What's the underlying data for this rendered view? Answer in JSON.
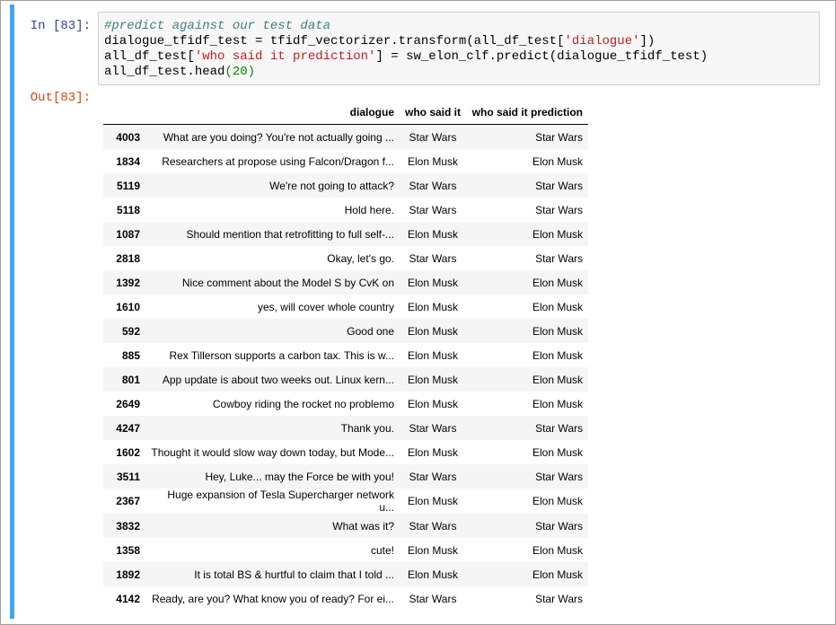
{
  "cell": {
    "in_prompt": "In [83]:",
    "out_prompt": "Out[83]:",
    "code": {
      "comment": "#predict against our test data",
      "line2_a": "dialogue_tfidf_test = tfidf_vectorizer.transform(all_df_test[",
      "line2_str": "'dialogue'",
      "line2_b": "])",
      "line3_a": "all_df_test[",
      "line3_str": "'who said it prediction'",
      "line3_b": "] = sw_elon_clf.predict(dialogue_tfidf_test)",
      "line4_a": "all_df_test.head",
      "line4_num": "(20)"
    }
  },
  "table": {
    "columns": [
      "",
      "dialogue",
      "who said it",
      "who said it prediction"
    ],
    "rows": [
      {
        "index": "4003",
        "dialogue": "What are you doing? You're not actually going ...",
        "who": "Star Wars",
        "pred": "Star Wars"
      },
      {
        "index": "1834",
        "dialogue": "Researchers at propose using Falcon/Dragon f...",
        "who": "Elon Musk",
        "pred": "Elon Musk"
      },
      {
        "index": "5119",
        "dialogue": "We're not going to attack?",
        "who": "Star Wars",
        "pred": "Star Wars"
      },
      {
        "index": "5118",
        "dialogue": "Hold here.",
        "who": "Star Wars",
        "pred": "Star Wars"
      },
      {
        "index": "1087",
        "dialogue": "Should mention that retrofitting to full self-...",
        "who": "Elon Musk",
        "pred": "Elon Musk"
      },
      {
        "index": "2818",
        "dialogue": "Okay, let's go.",
        "who": "Star Wars",
        "pred": "Star Wars"
      },
      {
        "index": "1392",
        "dialogue": "Nice comment about the Model S by CvK on",
        "who": "Elon Musk",
        "pred": "Elon Musk"
      },
      {
        "index": "1610",
        "dialogue": "yes, will cover whole country",
        "who": "Elon Musk",
        "pred": "Elon Musk"
      },
      {
        "index": "592",
        "dialogue": "Good one",
        "who": "Elon Musk",
        "pred": "Elon Musk"
      },
      {
        "index": "885",
        "dialogue": "Rex Tillerson supports a carbon tax. This is w...",
        "who": "Elon Musk",
        "pred": "Elon Musk"
      },
      {
        "index": "801",
        "dialogue": "App update is about two weeks out. Linux kern...",
        "who": "Elon Musk",
        "pred": "Elon Musk"
      },
      {
        "index": "2649",
        "dialogue": "Cowboy riding the rocket no problemo",
        "who": "Elon Musk",
        "pred": "Elon Musk"
      },
      {
        "index": "4247",
        "dialogue": "Thank you.",
        "who": "Star Wars",
        "pred": "Star Wars"
      },
      {
        "index": "1602",
        "dialogue": "Thought it would slow way down today, but Mode...",
        "who": "Elon Musk",
        "pred": "Elon Musk"
      },
      {
        "index": "3511",
        "dialogue": "Hey, Luke... may the Force be with you!",
        "who": "Star Wars",
        "pred": "Star Wars"
      },
      {
        "index": "2367",
        "dialogue": "Huge expansion of Tesla Supercharger network u...",
        "who": "Elon Musk",
        "pred": "Elon Musk"
      },
      {
        "index": "3832",
        "dialogue": "What was it?",
        "who": "Star Wars",
        "pred": "Star Wars"
      },
      {
        "index": "1358",
        "dialogue": "cute!",
        "who": "Elon Musk",
        "pred": "Elon Musk"
      },
      {
        "index": "1892",
        "dialogue": "It is total BS & hurtful to claim that I told ...",
        "who": "Elon Musk",
        "pred": "Elon Musk"
      },
      {
        "index": "4142",
        "dialogue": "Ready, are you? What know you of ready? For ei...",
        "who": "Star Wars",
        "pred": "Star Wars"
      }
    ]
  }
}
